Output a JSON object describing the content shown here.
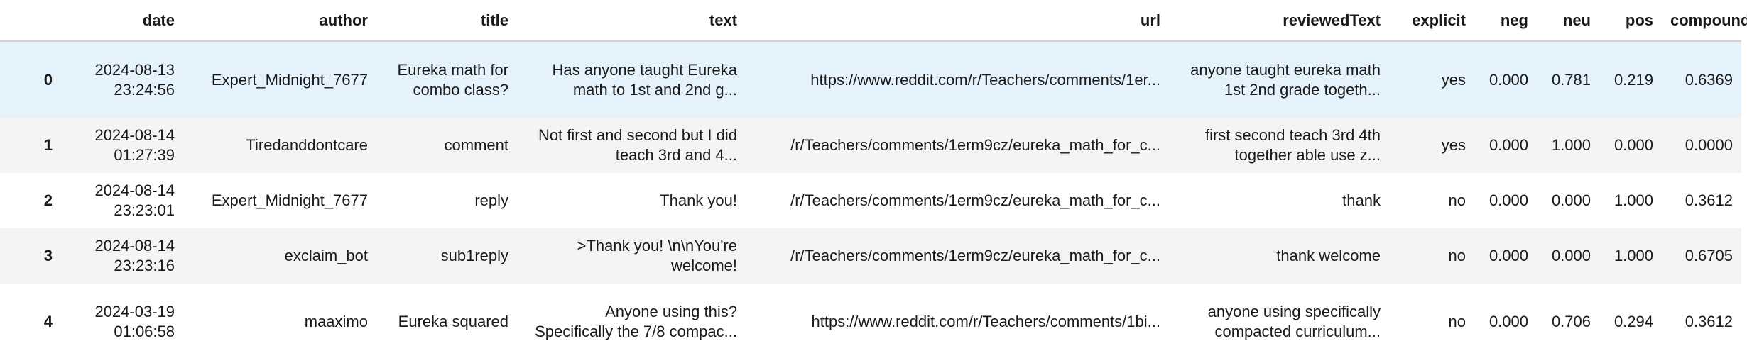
{
  "table": {
    "columns": [
      "",
      "date",
      "author",
      "title",
      "text",
      "url",
      "reviewedText",
      "explicit",
      "neg",
      "neu",
      "pos",
      "compound"
    ],
    "rows": [
      {
        "index": "0",
        "date": "2024-08-13 23:24:56",
        "author": "Expert_Midnight_7677",
        "title": "Eureka math for combo class?",
        "text": "Has anyone taught Eureka math to 1st and 2nd g...",
        "url": "https://www.reddit.com/r/Teachers/comments/1er...",
        "reviewedText": "anyone taught eureka math 1st 2nd grade togeth...",
        "explicit": "yes",
        "neg": "0.000",
        "neu": "0.781",
        "pos": "0.219",
        "compound": "0.6369"
      },
      {
        "index": "1",
        "date": "2024-08-14 01:27:39",
        "author": "Tiredanddontcare",
        "title": "comment",
        "text": "Not first and second but I did teach 3rd and 4...",
        "url": "/r/Teachers/comments/1erm9cz/eureka_math_for_c...",
        "reviewedText": "first second teach 3rd 4th together able use z...",
        "explicit": "yes",
        "neg": "0.000",
        "neu": "1.000",
        "pos": "0.000",
        "compound": "0.0000"
      },
      {
        "index": "2",
        "date": "2024-08-14 23:23:01",
        "author": "Expert_Midnight_7677",
        "title": "reply",
        "text": "Thank you!",
        "url": "/r/Teachers/comments/1erm9cz/eureka_math_for_c...",
        "reviewedText": "thank",
        "explicit": "no",
        "neg": "0.000",
        "neu": "0.000",
        "pos": "1.000",
        "compound": "0.3612"
      },
      {
        "index": "3",
        "date": "2024-08-14 23:23:16",
        "author": "exclaim_bot",
        "title": "sub1reply",
        "text": ">Thank you! \\n\\nYou're welcome!",
        "url": "/r/Teachers/comments/1erm9cz/eureka_math_for_c...",
        "reviewedText": "thank welcome",
        "explicit": "no",
        "neg": "0.000",
        "neu": "0.000",
        "pos": "1.000",
        "compound": "0.6705"
      },
      {
        "index": "4",
        "date": "2024-03-19 01:06:58",
        "author": "maaximo",
        "title": "Eureka squared",
        "text": "Anyone using this? Specifically the 7/8 compac...",
        "url": "https://www.reddit.com/r/Teachers/comments/1bi...",
        "reviewedText": "anyone using specifically compacted curriculum...",
        "explicit": "no",
        "neg": "0.000",
        "neu": "0.706",
        "pos": "0.294",
        "compound": "0.3612"
      }
    ]
  },
  "colors": {
    "row_hover": "#e3f2fb",
    "row_odd": "#f4f4f4",
    "row_even": "#ffffff",
    "header_rule": "#cfd4da"
  }
}
